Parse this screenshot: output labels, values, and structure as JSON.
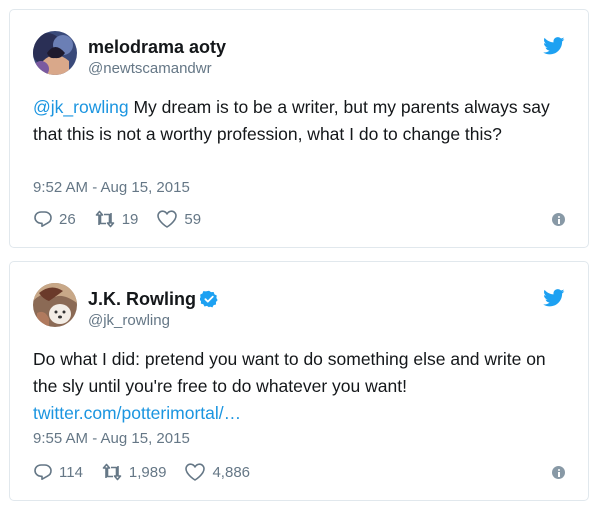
{
  "tweets": [
    {
      "display_name": "melodrama aoty",
      "handle": "@newtscamandwr",
      "mention": "@jk_rowling",
      "text": " My dream is to be a writer, but my parents always say that this is not a worthy profession, what I do to change this?",
      "timestamp": "9:52 AM - Aug 15, 2015",
      "replies": "26",
      "retweets": "19",
      "likes": "59"
    },
    {
      "display_name": "J.K. Rowling",
      "handle": "@jk_rowling",
      "verified": true,
      "text": "Do what I did: pretend you want to do something else and write on the sly until you're free to do whatever you want! ",
      "link": "twitter.com/potterimortal/…",
      "timestamp": "9:55 AM - Aug 15, 2015",
      "replies": "114",
      "retweets": "1,989",
      "likes": "4,886"
    }
  ],
  "colors": {
    "twitter_blue": "#1da1f2",
    "link": "#1b95e0",
    "muted": "#657786",
    "border": "#e1e8ed"
  },
  "icons": [
    "twitter-bird-icon",
    "reply-icon",
    "retweet-icon",
    "like-icon",
    "info-icon",
    "verified-badge-icon"
  ]
}
